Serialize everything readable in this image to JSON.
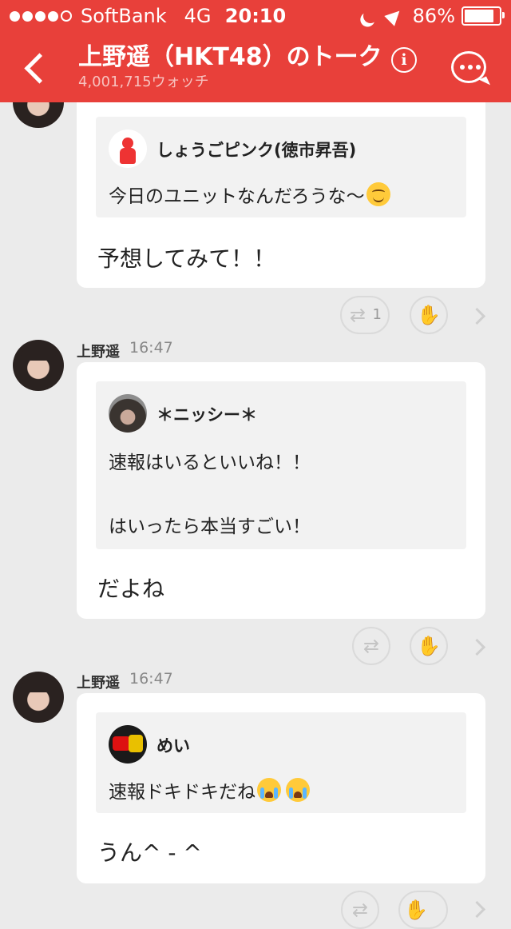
{
  "status_bar": {
    "carrier": "SoftBank",
    "network": "4G",
    "time": "20:10",
    "battery": "86%",
    "battery_level": 0.86
  },
  "header": {
    "title": "上野遥（HKT48）のトーク",
    "watch_count": "4,001,715ウォッチ",
    "info_glyph": "i"
  },
  "messages": [
    {
      "quote": {
        "name": "しょうごピンク(徳市昇吾)",
        "lines": [
          "今日のユニットなんだろうな〜"
        ],
        "emoji": "smile"
      },
      "reply": "予想してみて！！",
      "actions": {
        "retalk_count": "1"
      }
    },
    {
      "sender": "上野遥",
      "time": "16:47",
      "quote": {
        "name": "＊ニッシー＊",
        "lines": [
          "速報はいるといいね！！",
          "はいったら本当すごい！"
        ]
      },
      "reply": "だよね",
      "actions": {
        "retalk_count": ""
      }
    },
    {
      "sender": "上野遥",
      "time": "16:47",
      "quote": {
        "name": "めい",
        "lines": [
          "速報ドキドキだね"
        ],
        "emoji": "cry-cry"
      },
      "reply": "うん^ - ^",
      "actions": {
        "retalk_count": ""
      }
    }
  ],
  "icons": {
    "retalk": "retweet-icon",
    "applause": "hands-icon",
    "more": "chevron-right-icon"
  },
  "colors": {
    "header": "#e8403a",
    "background": "#ebebeb",
    "bubble": "#ffffff",
    "quote": "#f2f2f2"
  }
}
